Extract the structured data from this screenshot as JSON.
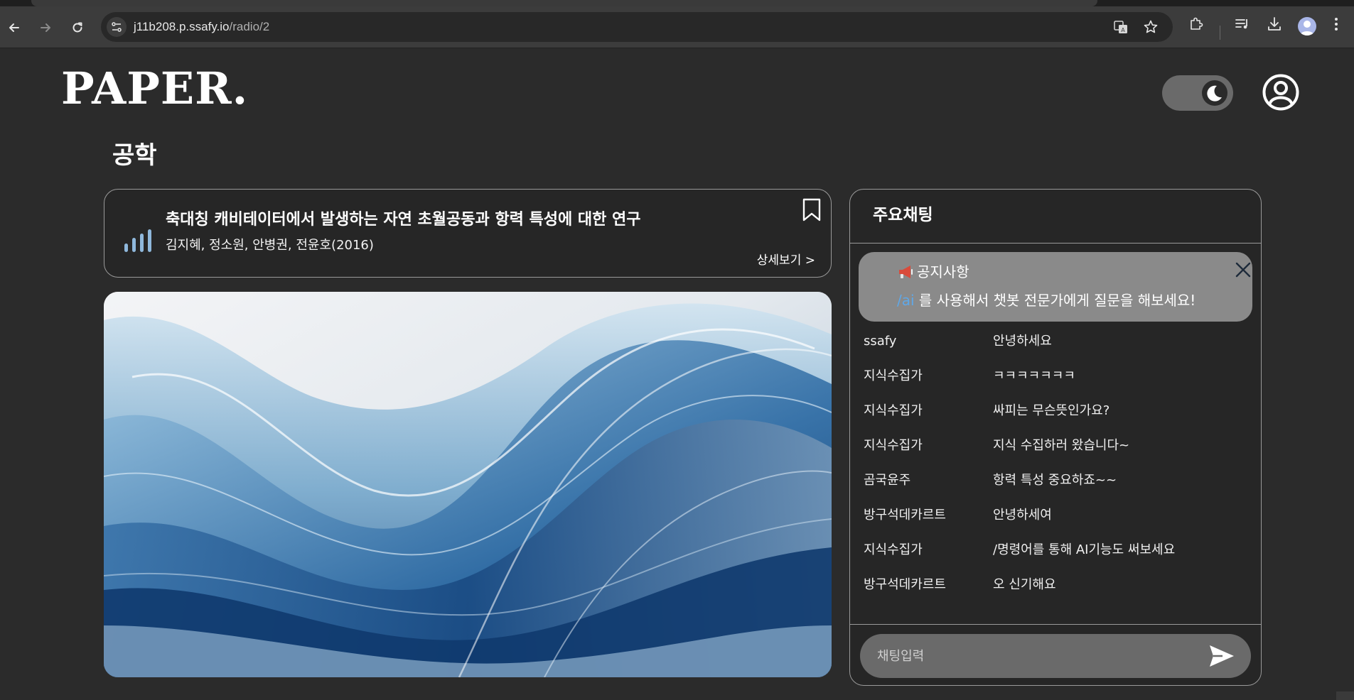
{
  "browser": {
    "url_host": "j11b208.p.ssafy.io",
    "url_path": "/radio/2"
  },
  "header": {
    "logo": "PAPER."
  },
  "page": {
    "category": "공학"
  },
  "paper": {
    "title": "축대칭 캐비테이터에서 발생하는 자연 초월공동과 항력 특성에 대한 연구",
    "authors": "김지혜, 정소원, 안병권, 전윤호(2016)",
    "detail_label": "상세보기 >"
  },
  "chat": {
    "title": "주요채팅",
    "notice": {
      "title": "공지사항",
      "command": "/ai",
      "body": " 를 사용해서 챗봇 전문가에게 질문을 해보세요!"
    },
    "messages": [
      {
        "user": "ssafy",
        "text": "안녕하세요"
      },
      {
        "user": "지식수집가",
        "text": "ㅋㅋㅋㅋㅋㅋㅋ"
      },
      {
        "user": "지식수집가",
        "text": "싸피는 무슨뜻인가요?"
      },
      {
        "user": "지식수집가",
        "text": "지식 수집하러 왔습니다~"
      },
      {
        "user": "곰국윤주",
        "text": "항력 특성 중요하죠~~"
      },
      {
        "user": "방구석데카르트",
        "text": "안녕하세여"
      },
      {
        "user": "지식수집가",
        "text": "/명령어를 통해 AI기능도 써보세요"
      },
      {
        "user": "방구석데카르트",
        "text": "오 신기해요"
      }
    ],
    "input_placeholder": "채팅입력",
    "input_value": ""
  },
  "colors": {
    "background": "#2b2b2b",
    "accent_command": "#5fa8e8",
    "notice_bg": "#8a8a8a",
    "audio_bars": "#8fb8dc"
  },
  "icons": {
    "back": "arrow-left-icon",
    "forward": "arrow-right-icon",
    "reload": "reload-icon",
    "site_info": "tune-icon",
    "translate": "translate-icon",
    "star": "star-icon",
    "extensions": "puzzle-icon",
    "media": "media-queue-icon",
    "download": "download-icon",
    "menu": "kebab-menu-icon",
    "theme": "moon-icon",
    "account": "account-icon",
    "bookmark": "bookmark-icon",
    "audio": "audio-bars-icon",
    "megaphone": "megaphone-icon",
    "close": "close-icon",
    "send": "send-icon"
  }
}
